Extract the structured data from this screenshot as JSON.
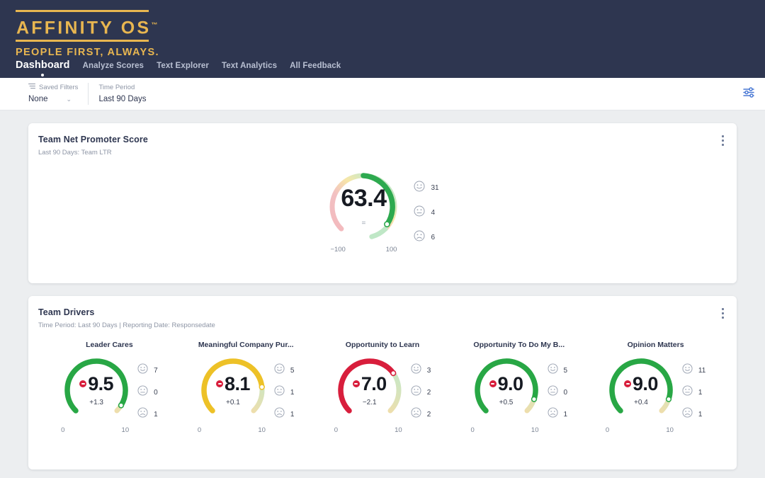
{
  "brand": {
    "name": "AFFINITY OS",
    "tm": "™",
    "tagline": "PEOPLE FIRST, ALWAYS.",
    "accent": "#e8b650",
    "header_bg": "#2e3650"
  },
  "nav": {
    "items": [
      {
        "label": "Dashboard",
        "active": true
      },
      {
        "label": "Analyze Scores",
        "active": false
      },
      {
        "label": "Text Explorer",
        "active": false
      },
      {
        "label": "Text Analytics",
        "active": false
      },
      {
        "label": "All Feedback",
        "active": false
      }
    ]
  },
  "filterbar": {
    "saved_filters": {
      "icon": "filter-lines-icon",
      "label": "Saved Filters",
      "value": "None",
      "chevron": "⌄"
    },
    "time_period": {
      "label": "Time Period",
      "value": "Last 90 Days"
    },
    "settings_icon": "sliders-icon"
  },
  "nps_card": {
    "title": "Team Net Promoter Score",
    "subtitle": "Last 90 Days: Team LTR",
    "menu_icon": "kebab-menu-icon",
    "gauge": {
      "value": "63.4",
      "trend_symbol": "=",
      "scale_min": "−100",
      "scale_max": "100",
      "value_color": "#2da94f"
    },
    "faces": [
      {
        "icon": "smile-face-icon",
        "count": "31"
      },
      {
        "icon": "neutral-face-icon",
        "count": "4"
      },
      {
        "icon": "frown-face-icon",
        "count": "6"
      }
    ]
  },
  "drivers_card": {
    "title": "Team Drivers",
    "subtitle": "Time Period: Last 90 Days | Reporting Date: Responsedate",
    "menu_icon": "kebab-menu-icon",
    "scale_min": "0",
    "scale_max": "10",
    "items": [
      {
        "title": "Leader Cares",
        "value": "9.5",
        "delta": "+1.3",
        "color": "#28a745",
        "faces": [
          {
            "icon": "smile-face-icon",
            "count": "7"
          },
          {
            "icon": "neutral-face-icon",
            "count": "0"
          },
          {
            "icon": "frown-face-icon",
            "count": "1"
          }
        ]
      },
      {
        "title": "Meaningful Company Pur...",
        "value": "8.1",
        "delta": "+0.1",
        "color": "#edc127",
        "faces": [
          {
            "icon": "smile-face-icon",
            "count": "5"
          },
          {
            "icon": "neutral-face-icon",
            "count": "1"
          },
          {
            "icon": "frown-face-icon",
            "count": "1"
          }
        ]
      },
      {
        "title": "Opportunity to Learn",
        "value": "7.0",
        "delta": "−2.1",
        "color": "#d81e3c",
        "faces": [
          {
            "icon": "smile-face-icon",
            "count": "3"
          },
          {
            "icon": "neutral-face-icon",
            "count": "2"
          },
          {
            "icon": "frown-face-icon",
            "count": "2"
          }
        ]
      },
      {
        "title": "Opportunity To Do My B...",
        "value": "9.0",
        "delta": "+0.5",
        "color": "#28a745",
        "faces": [
          {
            "icon": "smile-face-icon",
            "count": "5"
          },
          {
            "icon": "neutral-face-icon",
            "count": "0"
          },
          {
            "icon": "frown-face-icon",
            "count": "1"
          }
        ]
      },
      {
        "title": "Opinion Matters",
        "value": "9.0",
        "delta": "+0.4",
        "color": "#28a745",
        "faces": [
          {
            "icon": "smile-face-icon",
            "count": "11"
          },
          {
            "icon": "neutral-face-icon",
            "count": "1"
          },
          {
            "icon": "frown-face-icon",
            "count": "1"
          }
        ]
      }
    ]
  },
  "chart_data": [
    {
      "type": "gauge",
      "title": "Team Net Promoter Score",
      "subtitle": "Last 90 Days: Team LTR",
      "value": 63.4,
      "range": [
        -100,
        100
      ],
      "trend": "=",
      "segments": [
        {
          "name": "Promoters",
          "value": 31
        },
        {
          "name": "Passives",
          "value": 4
        },
        {
          "name": "Detractors",
          "value": 6
        }
      ]
    },
    {
      "type": "gauge",
      "title": "Team Drivers",
      "range": [
        0,
        10
      ],
      "categories": [
        "Leader Cares",
        "Meaningful Company Pur...",
        "Opportunity to Learn",
        "Opportunity To Do My B...",
        "Opinion Matters"
      ],
      "values": [
        9.5,
        8.1,
        7.0,
        9.0,
        9.0
      ],
      "deltas": [
        1.3,
        0.1,
        -2.1,
        0.5,
        0.4
      ],
      "positive_counts": [
        7,
        5,
        3,
        5,
        11
      ],
      "neutral_counts": [
        0,
        1,
        2,
        0,
        1
      ],
      "negative_counts": [
        1,
        1,
        2,
        1,
        1
      ]
    }
  ]
}
